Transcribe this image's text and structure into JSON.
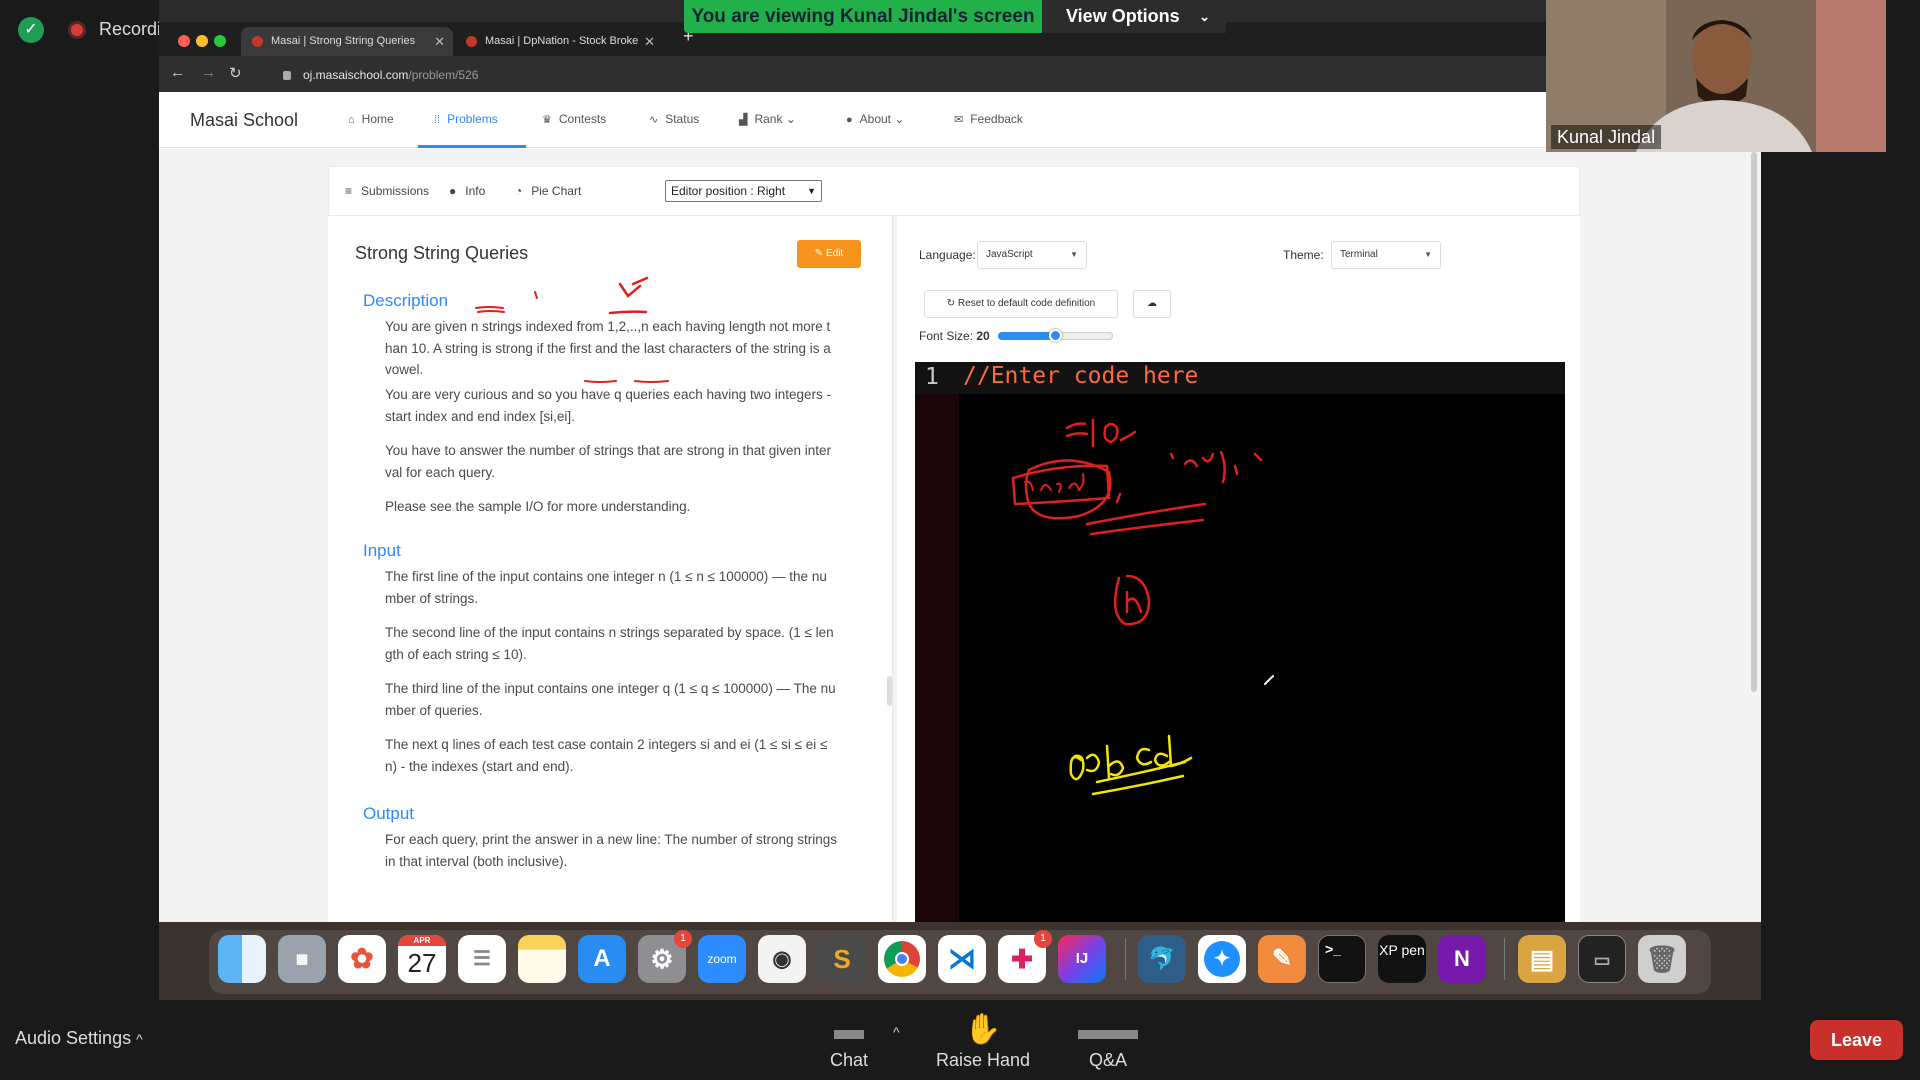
{
  "zoom": {
    "recording_label": "Recording",
    "viewing_banner": "You are viewing Kunal Jindal's screen",
    "view_options": "View Options",
    "participant_name": "Kunal Jindal",
    "audio_settings": "Audio Settings",
    "chat": "Chat",
    "raise_hand": "Raise Hand",
    "qa": "Q&A",
    "leave": "Leave"
  },
  "browser": {
    "tabs": [
      {
        "title": "Masai | Strong String Queries"
      },
      {
        "title": "Masai | DpNation - Stock Broke"
      }
    ],
    "url_host": "oj.masaischool.com",
    "url_path": "/problem/526"
  },
  "site": {
    "brand": "Masai School",
    "nav": {
      "home": "Home",
      "problems": "Problems",
      "contests": "Contests",
      "status": "Status",
      "rank": "Rank",
      "about": "About",
      "feedback": "Feedback"
    },
    "subbar": {
      "submissions": "Submissions",
      "info": "Info",
      "pie_chart": "Pie Chart",
      "editor_position": "Editor position : Right"
    }
  },
  "problem": {
    "title": "Strong String Queries",
    "edit_label": "Edit",
    "description_heading": "Description",
    "description": [
      "You are given n strings indexed from 1,2,..,n each having length not more than 10. A string is strong if the first and the last characters of the string is a vowel.",
      "You are very curious and so you have q queries each having two integers - start index and end index [si,ei].",
      "You have to answer the number of strings that are strong in that given interval for each query.",
      "Please see the sample I/O for more understanding."
    ],
    "input_heading": "Input",
    "input": [
      "The first line of the input contains one integer n (1 ≤ n ≤ 100000) — the number of strings.",
      "The second line of the input contains n strings separated by space. (1 ≤ length of each string ≤ 10).",
      "The third line of the input contains one integer q (1 ≤ q ≤ 100000) — The number of queries.",
      "The next q lines of each test case contain 2 integers si and ei (1 ≤ si ≤ ei ≤ n) - the indexes (start and end)."
    ],
    "output_heading": "Output",
    "output": [
      "For each query, print the answer in a new line: The number of strong strings in that interval (both inclusive)."
    ]
  },
  "editor": {
    "language_label": "Language:",
    "language_value": "JavaScript",
    "theme_label": "Theme:",
    "theme_value": "Terminal",
    "reset_label": "Reset to default code definition",
    "font_size_label": "Font Size:",
    "font_size_value": "20",
    "font_size_slider_fraction": 0.5,
    "line_number": "1",
    "code": "//Enter code here"
  },
  "dock": {
    "calendar_month": "APR",
    "calendar_day": "27",
    "zoom_label": "zoom",
    "settings_badge": "1",
    "slack_badge": "1",
    "intellij_label": "IJ",
    "xppen_label": "XP pen",
    "onenote_label": "N",
    "terminal_label": ">_",
    "apps": [
      "finder-icon",
      "launchpad-icon",
      "photos-icon",
      "calendar-icon",
      "reminders-icon",
      "notes-icon",
      "app-store-icon",
      "system-preferences-icon",
      "zoom-icon",
      "cyberduck-icon",
      "sublime-text-icon",
      "chrome-icon",
      "vscode-icon",
      "slack-icon",
      "intellij-icon",
      "mysql-workbench-icon",
      "safari-icon",
      "sketch-pen-icon",
      "terminal-icon",
      "xp-pen-icon",
      "onenote-icon",
      "downloads-stack-icon",
      "desktop-stack-icon",
      "trash-icon"
    ]
  },
  "colors": {
    "accent": "#2d8cf0",
    "edit_button": "#f7941d",
    "code_text": "#ff6a3c",
    "viewing_banner": "#22b04b",
    "leave_button": "#c9302c",
    "annotation_red": "#e0201c",
    "annotation_yellow": "#f2e600"
  }
}
